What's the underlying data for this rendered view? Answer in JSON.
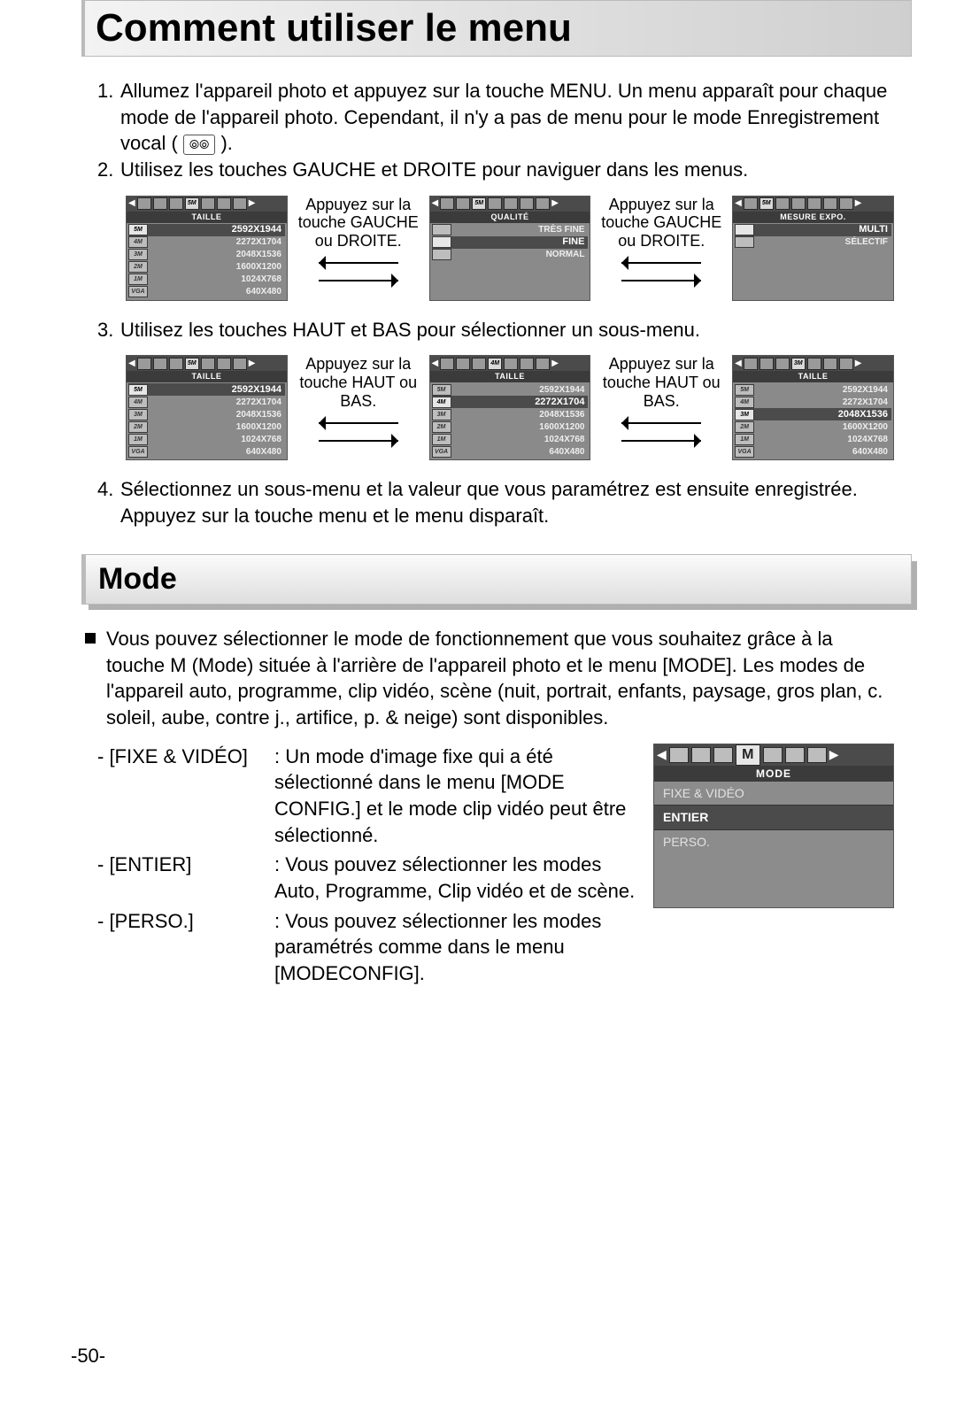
{
  "title": "Comment utiliser le menu",
  "step1_num": "1.",
  "step1_text": "Allumez l'appareil photo et appuyez sur la touche MENU. Un menu apparaît pour chaque mode de l'appareil photo. Cependant, il n'y a pas de menu pour le mode Enregistrement vocal ( ",
  "step1_end": " ).",
  "step2_num": "2.",
  "step2_text": "Utilisez les touches GAUCHE et DROITE pour naviguer dans les menus.",
  "step3_num": "3.",
  "step3_text": "Utilisez les touches HAUT et BAS pour sélectionner un sous-menu.",
  "step4_num": "4.",
  "step4_text": "Sélectionnez un sous-menu et la valeur que vous paramétrez est ensuite enregistrée. Appuyez sur la touche menu et le menu disparaît.",
  "hint_lr": "Appuyez sur la touche GAUCHE ou DROITE.",
  "hint_ud": "Appuyez sur la touche HAUT ou BAS.",
  "taille_heading": "TAILLE",
  "qualite_heading": "QUALITÉ",
  "mesure_heading": "MESURE EXPO.",
  "sizes": {
    "b5": "5M",
    "b4": "4M",
    "b3": "3M",
    "b2": "2M",
    "b1": "1M",
    "bv": "VGA",
    "r0": "2592X1944",
    "r1": "2272X1704",
    "r2": "2048X1536",
    "r3": "1600X1200",
    "r4": "1024X768",
    "r5": "640X480"
  },
  "quality": {
    "q0": "TRÈS FINE",
    "q1": "FINE",
    "q2": "NORMAL"
  },
  "mesure": {
    "m0": "MULTI",
    "m1": "SÉLECTIF"
  },
  "tab_sel_5m": "5M",
  "tab_sel_4m": "4M",
  "tab_sel_3m": "3M",
  "mode_heading": "Mode",
  "mode_intro": "Vous pouvez sélectionner le mode de fonctionnement que vous souhaitez grâce à la touche M (Mode) située à l'arrière de l'appareil photo et le menu [MODE]. Les modes de l'appareil auto, programme, clip vidéo, scène (nuit, portrait, enfants, paysage, gros plan, c. soleil, aube, contre j., artifice, p. & neige) sont disponibles.",
  "mode_defs": {
    "k0": "- [FIXE & VIDÉO]",
    "d0": ": Un mode d'image fixe qui a été sélectionné dans le menu [MODE CONFIG.] et le mode clip vidéo peut être sélectionné.",
    "k1": "- [ENTIER]",
    "d1": ": Vous pouvez sélectionner les modes Auto, Programme, Clip vidéo et de scène.",
    "k2": "- [PERSO.]",
    "d2": ": Vous pouvez sélectionner les modes paramétrés comme dans le menu [MODECONFIG]."
  },
  "mode_panel": {
    "heading": "MODE",
    "m_big": "M",
    "r0": "FIXE & VIDÉO",
    "r1": "ENTIER",
    "r2": "PERSO."
  },
  "page_number": "-50-"
}
